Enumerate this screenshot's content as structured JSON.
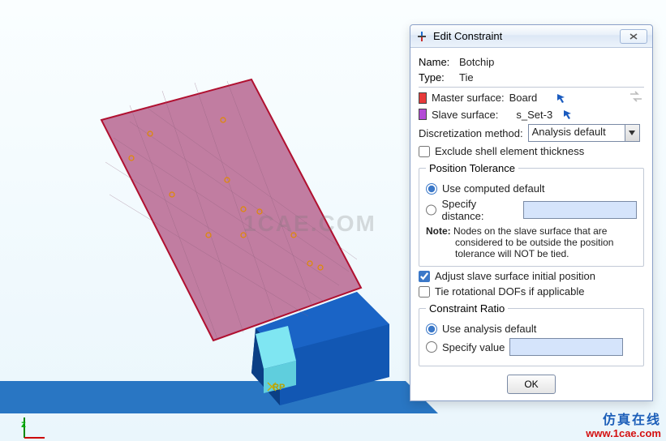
{
  "viewport": {
    "watermark": "1CAE.COM",
    "axis_z": "z",
    "rp_label": "RP"
  },
  "brand": {
    "cn": "仿真在线",
    "url": "www.1cae.com"
  },
  "dialog": {
    "title": "Edit Constraint",
    "name_label": "Name:",
    "name_value": "Botchip",
    "type_label": "Type:",
    "type_value": "Tie",
    "master_label": "Master surface:",
    "master_value": "Board",
    "slave_label": "Slave surface:",
    "slave_value": "s_Set-3",
    "disc_label": "Discretization method:",
    "disc_value": "Analysis default",
    "exclude_label": "Exclude shell element thickness",
    "exclude_checked": false,
    "pos_tol": {
      "legend": "Position Tolerance",
      "use_computed": "Use computed default",
      "specify_distance": "Specify distance:",
      "selected": "use_computed",
      "note_label": "Note:",
      "note_line1": "Nodes on the slave surface that are",
      "note_line2": "considered to be outside the position",
      "note_line3": "tolerance will NOT be tied."
    },
    "adjust_label": "Adjust slave surface initial position",
    "adjust_checked": true,
    "tierot_label": "Tie rotational DOFs if applicable",
    "tierot_checked": false,
    "ratio": {
      "legend": "Constraint Ratio",
      "use_default": "Use analysis default",
      "specify_value": "Specify value",
      "selected": "use_default"
    },
    "ok_label": "OK"
  }
}
